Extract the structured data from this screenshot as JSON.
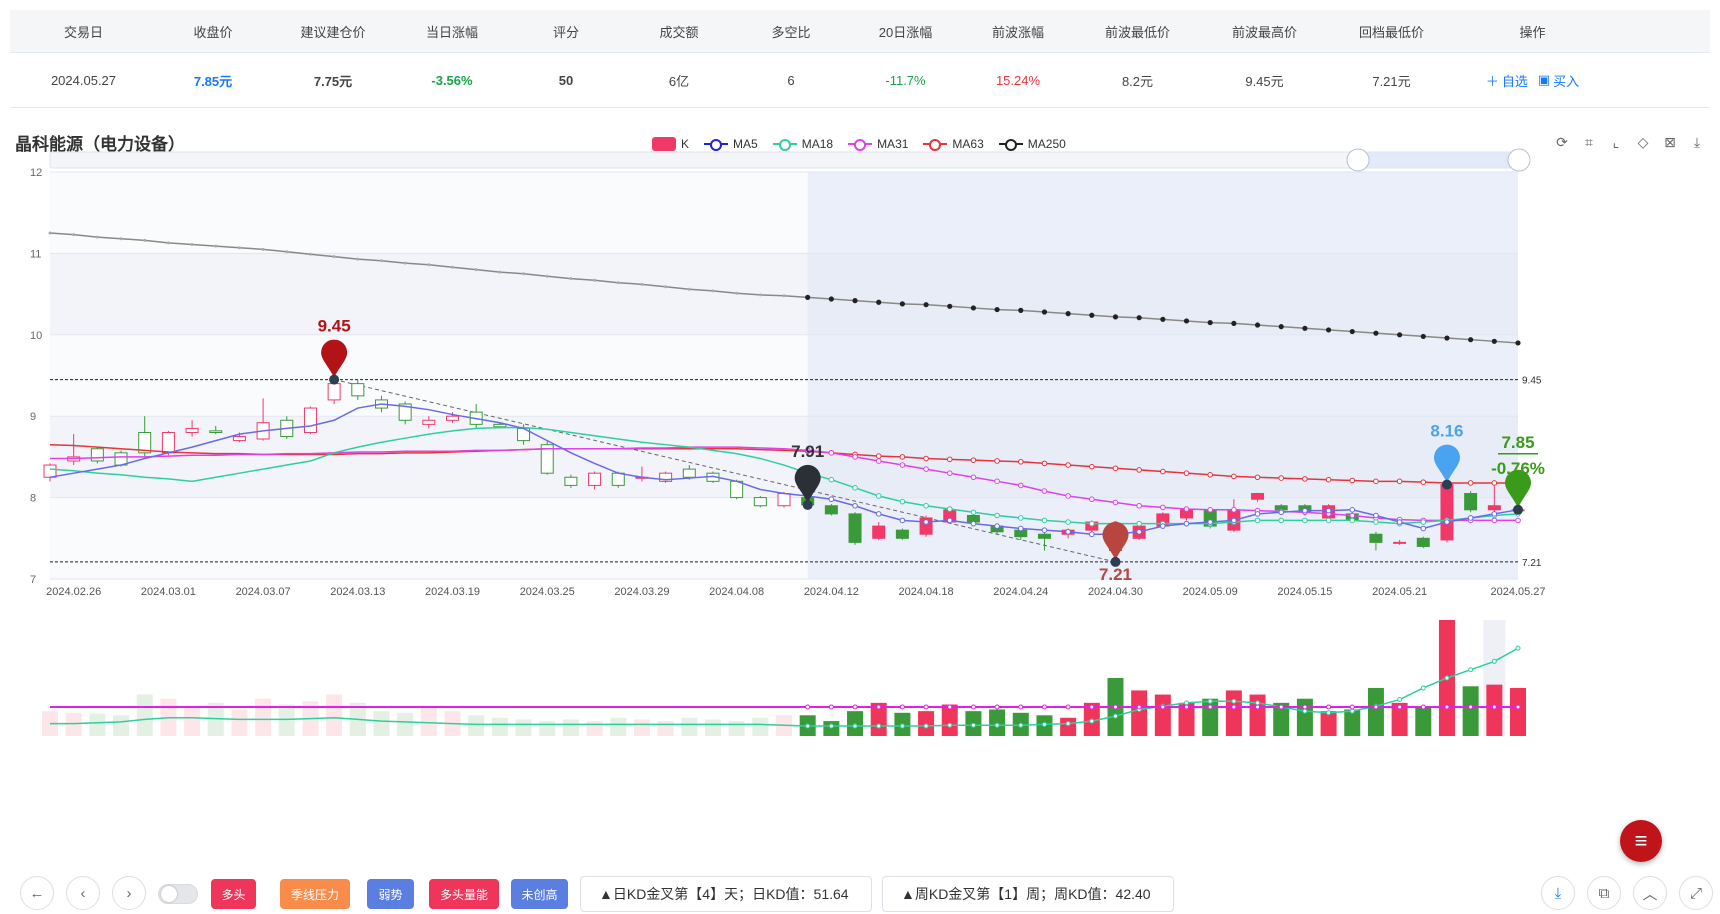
{
  "table": {
    "headers": [
      "交易日",
      "收盘价",
      "建议建仓价",
      "当日涨幅",
      "评分",
      "成交额",
      "多空比",
      "20日涨幅",
      "前波涨幅",
      "前波最低价",
      "前波最高价",
      "回档最低价",
      "操作"
    ],
    "row": {
      "trade_date": "2024.05.27",
      "close": "7.85元",
      "suggest_price": "7.75元",
      "day_change": "-3.56%",
      "score": "50",
      "amount": "6亿",
      "bull_bear": "6",
      "change_20d": "-11.7%",
      "prev_wave_change": "15.24%",
      "prev_wave_low": "8.2元",
      "prev_wave_high": "9.45元",
      "pullback_low": "7.21元"
    },
    "actions": {
      "watchlist": "自选",
      "buy": "买入"
    }
  },
  "chart_title": "晶科能源（电力设备）",
  "legend": [
    {
      "name": "K",
      "color": "#f03968"
    },
    {
      "name": "MA5",
      "color": "#2323d8"
    },
    {
      "name": "MA18",
      "color": "#2ecf9e"
    },
    {
      "name": "MA31",
      "color": "#e040e8"
    },
    {
      "name": "MA63",
      "color": "#e8333a"
    },
    {
      "name": "MA250",
      "color": "#222222"
    }
  ],
  "toolbox_icons": [
    "refresh-icon",
    "zoom-select-icon",
    "zoom-reset-icon",
    "restore-icon",
    "data-view-icon",
    "download-icon"
  ],
  "chart_data": {
    "type": "candlestick",
    "ylim": [
      7,
      12
    ],
    "yticks": [
      "12",
      "11",
      "10",
      "9",
      "8",
      "7"
    ],
    "xticks": [
      "2024.02.26",
      "2024.03.01",
      "2024.03.07",
      "2024.03.13",
      "2024.03.19",
      "2024.03.25",
      "2024.03.29",
      "2024.04.08",
      "2024.04.12",
      "2024.04.18",
      "2024.04.24",
      "2024.04.30",
      "2024.05.09",
      "2024.05.15",
      "2024.05.21",
      "2024.05.27"
    ],
    "candles": [
      [
        8.25,
        8.4,
        8.2,
        8.42
      ],
      [
        8.45,
        8.5,
        8.4,
        8.78
      ],
      [
        8.6,
        8.45,
        8.42,
        8.62
      ],
      [
        8.55,
        8.4,
        8.38,
        8.58
      ],
      [
        8.8,
        8.55,
        8.5,
        9.0
      ],
      [
        8.55,
        8.8,
        8.52,
        8.82
      ],
      [
        8.8,
        8.85,
        8.75,
        8.95
      ],
      [
        8.82,
        8.8,
        8.78,
        8.88
      ],
      [
        8.7,
        8.75,
        8.68,
        8.8
      ],
      [
        8.72,
        8.92,
        8.7,
        9.22
      ],
      [
        8.95,
        8.75,
        8.72,
        9.0
      ],
      [
        8.8,
        9.1,
        8.78,
        9.12
      ],
      [
        9.2,
        9.4,
        9.15,
        9.45
      ],
      [
        9.4,
        9.25,
        9.2,
        9.45
      ],
      [
        9.2,
        9.1,
        9.05,
        9.25
      ],
      [
        9.15,
        8.95,
        8.9,
        9.18
      ],
      [
        8.9,
        8.95,
        8.85,
        9.0
      ],
      [
        8.95,
        9.0,
        8.92,
        9.05
      ],
      [
        9.05,
        8.9,
        8.85,
        9.15
      ],
      [
        8.9,
        8.87,
        8.85,
        8.92
      ],
      [
        8.85,
        8.7,
        8.65,
        8.9
      ],
      [
        8.65,
        8.3,
        8.28,
        8.7
      ],
      [
        8.25,
        8.15,
        8.12,
        8.28
      ],
      [
        8.15,
        8.3,
        8.1,
        8.32
      ],
      [
        8.3,
        8.15,
        8.12,
        8.32
      ],
      [
        8.25,
        8.25,
        8.2,
        8.38
      ],
      [
        8.2,
        8.3,
        8.18,
        8.32
      ],
      [
        8.35,
        8.25,
        8.22,
        8.4
      ],
      [
        8.3,
        8.2,
        8.18,
        8.32
      ],
      [
        8.2,
        8.0,
        7.98,
        8.22
      ],
      [
        8.0,
        7.9,
        7.88,
        8.02
      ],
      [
        7.9,
        8.05,
        7.88,
        8.07
      ],
      [
        8.0,
        7.91,
        7.88,
        8.3
      ],
      [
        7.9,
        7.8,
        7.78,
        7.92
      ],
      [
        7.8,
        7.45,
        7.42,
        7.82
      ],
      [
        7.5,
        7.65,
        7.48,
        7.7
      ],
      [
        7.6,
        7.5,
        7.48,
        7.62
      ],
      [
        7.55,
        7.75,
        7.52,
        7.78
      ],
      [
        7.7,
        7.85,
        7.68,
        7.87
      ],
      [
        7.78,
        7.7,
        7.65,
        7.8
      ],
      [
        7.65,
        7.58,
        7.55,
        7.68
      ],
      [
        7.6,
        7.52,
        7.48,
        7.62
      ],
      [
        7.55,
        7.5,
        7.35,
        7.58
      ],
      [
        7.55,
        7.6,
        7.5,
        7.62
      ],
      [
        7.6,
        7.7,
        7.55,
        7.72
      ],
      [
        7.65,
        7.35,
        7.21,
        7.68
      ],
      [
        7.5,
        7.65,
        7.48,
        7.68
      ],
      [
        7.65,
        7.8,
        7.62,
        7.82
      ],
      [
        7.75,
        7.85,
        7.72,
        7.88
      ],
      [
        7.85,
        7.65,
        7.62,
        7.88
      ],
      [
        7.6,
        7.85,
        7.58,
        7.98
      ],
      [
        7.98,
        8.05,
        7.95,
        8.06
      ],
      [
        7.9,
        7.85,
        7.82,
        7.92
      ],
      [
        7.9,
        7.82,
        7.78,
        7.92
      ],
      [
        7.75,
        7.9,
        7.7,
        7.92
      ],
      [
        7.8,
        7.72,
        7.7,
        7.82
      ],
      [
        7.55,
        7.45,
        7.35,
        7.58
      ],
      [
        7.45,
        7.45,
        7.42,
        7.48
      ],
      [
        7.5,
        7.4,
        7.38,
        7.52
      ],
      [
        7.48,
        8.16,
        7.45,
        8.18
      ],
      [
        8.05,
        7.85,
        7.82,
        8.08
      ],
      [
        7.85,
        7.9,
        7.82,
        8.2
      ],
      [
        7.85,
        7.85,
        7.8,
        7.9
      ]
    ],
    "ma5": [
      8.25,
      8.3,
      8.35,
      8.4,
      8.48,
      8.55,
      8.62,
      8.7,
      8.78,
      8.82,
      8.85,
      8.88,
      8.95,
      9.1,
      9.15,
      9.12,
      9.08,
      9.02,
      8.97,
      8.92,
      8.85,
      8.7,
      8.55,
      8.42,
      8.3,
      8.25,
      8.22,
      8.24,
      8.26,
      8.2,
      8.1,
      8.05,
      8.02,
      7.98,
      7.9,
      7.8,
      7.72,
      7.7,
      7.72,
      7.68,
      7.65,
      7.62,
      7.6,
      7.58,
      7.55,
      7.55,
      7.58,
      7.65,
      7.68,
      7.7,
      7.72,
      7.8,
      7.82,
      7.84,
      7.84,
      7.85,
      7.78,
      7.7,
      7.62,
      7.7,
      7.75,
      7.8,
      7.85
    ],
    "ma18": [
      8.35,
      8.33,
      8.3,
      8.28,
      8.25,
      8.23,
      8.2,
      8.25,
      8.3,
      8.35,
      8.4,
      8.45,
      8.55,
      8.62,
      8.68,
      8.73,
      8.78,
      8.82,
      8.85,
      8.86,
      8.86,
      8.84,
      8.8,
      8.76,
      8.72,
      8.68,
      8.65,
      8.62,
      8.58,
      8.54,
      8.48,
      8.4,
      8.3,
      8.22,
      8.12,
      8.02,
      7.95,
      7.9,
      7.86,
      7.82,
      7.78,
      7.75,
      7.72,
      7.7,
      7.68,
      7.68,
      7.68,
      7.68,
      7.68,
      7.68,
      7.7,
      7.72,
      7.72,
      7.72,
      7.72,
      7.72,
      7.7,
      7.68,
      7.7,
      7.72,
      7.75,
      7.78,
      7.8
    ],
    "ma31": [
      8.48,
      8.48,
      8.49,
      8.5,
      8.5,
      8.51,
      8.52,
      8.52,
      8.53,
      8.53,
      8.54,
      8.54,
      8.55,
      8.56,
      8.56,
      8.57,
      8.57,
      8.57,
      8.58,
      8.58,
      8.59,
      8.6,
      8.6,
      8.6,
      8.6,
      8.61,
      8.61,
      8.62,
      8.62,
      8.62,
      8.61,
      8.6,
      8.58,
      8.55,
      8.5,
      8.45,
      8.4,
      8.35,
      8.3,
      8.25,
      8.2,
      8.15,
      8.08,
      8.02,
      7.98,
      7.94,
      7.9,
      7.88,
      7.86,
      7.85,
      7.85,
      7.84,
      7.83,
      7.82,
      7.8,
      7.78,
      7.75,
      7.73,
      7.72,
      7.72,
      7.72,
      7.72,
      7.72
    ],
    "ma63": [
      8.65,
      8.64,
      8.62,
      8.6,
      8.58,
      8.56,
      8.55,
      8.54,
      8.54,
      8.53,
      8.53,
      8.53,
      8.53,
      8.54,
      8.54,
      8.55,
      8.55,
      8.56,
      8.57,
      8.58,
      8.59,
      8.6,
      8.6,
      8.6,
      8.6,
      8.6,
      8.6,
      8.6,
      8.6,
      8.6,
      8.59,
      8.58,
      8.57,
      8.55,
      8.53,
      8.51,
      8.5,
      8.48,
      8.47,
      8.46,
      8.45,
      8.44,
      8.42,
      8.4,
      8.38,
      8.36,
      8.34,
      8.32,
      8.3,
      8.28,
      8.26,
      8.25,
      8.24,
      8.23,
      8.22,
      8.21,
      8.2,
      8.2,
      8.19,
      8.18,
      8.18,
      8.18,
      8.18
    ],
    "ma250": [
      11.25,
      11.23,
      11.2,
      11.18,
      11.16,
      11.13,
      11.11,
      11.09,
      11.07,
      11.05,
      11.02,
      10.99,
      10.96,
      10.93,
      10.91,
      10.88,
      10.86,
      10.83,
      10.8,
      10.77,
      10.75,
      10.72,
      10.69,
      10.67,
      10.64,
      10.62,
      10.59,
      10.56,
      10.54,
      10.51,
      10.49,
      10.48,
      10.46,
      10.44,
      10.42,
      10.4,
      10.38,
      10.37,
      10.35,
      10.33,
      10.31,
      10.3,
      10.28,
      10.26,
      10.24,
      10.22,
      10.21,
      10.19,
      10.17,
      10.15,
      10.14,
      10.12,
      10.1,
      10.08,
      10.06,
      10.04,
      10.02,
      10.0,
      9.98,
      9.96,
      9.94,
      9.92,
      9.9
    ],
    "volume": [
      30,
      28,
      27,
      25,
      50,
      45,
      35,
      40,
      32,
      45,
      38,
      42,
      50,
      40,
      30,
      28,
      35,
      30,
      25,
      22,
      20,
      18,
      20,
      18,
      22,
      20,
      18,
      22,
      20,
      18,
      22,
      25,
      25,
      18,
      30,
      40,
      28,
      30,
      38,
      30,
      32,
      28,
      25,
      22,
      40,
      70,
      55,
      50,
      40,
      45,
      55,
      50,
      40,
      45,
      30,
      32,
      58,
      40,
      35,
      140,
      60,
      62,
      58
    ],
    "vol_line_a": [
      15,
      15,
      16,
      17,
      20,
      22,
      22,
      21,
      20,
      20,
      20,
      21,
      22,
      20,
      18,
      17,
      16,
      15,
      14,
      14,
      14,
      14,
      14,
      14,
      14,
      14,
      14,
      14,
      14,
      14,
      14,
      13,
      12,
      12,
      12,
      12,
      12,
      12,
      13,
      13,
      13,
      13,
      14,
      15,
      18,
      24,
      32,
      36,
      40,
      42,
      42,
      40,
      35,
      30,
      28,
      30,
      36,
      44,
      58,
      70,
      80,
      90,
      106
    ],
    "vol_line_b": [
      35,
      35,
      35,
      35,
      35,
      35,
      35,
      35,
      35,
      35,
      35,
      35,
      35,
      35,
      35,
      35,
      35,
      35,
      35,
      35,
      35,
      35,
      35,
      35,
      35,
      35,
      35,
      35,
      35,
      35,
      35,
      35,
      35,
      35,
      35,
      35,
      35,
      35,
      35,
      35,
      35,
      35,
      35,
      35,
      35,
      35,
      35,
      35,
      35,
      35,
      35,
      35,
      35,
      35,
      35,
      35,
      35,
      35,
      35,
      35,
      35,
      35,
      35
    ],
    "annotations": {
      "high_label": "9.45",
      "mid_label": "7.91",
      "low_label": "7.21",
      "recent_label": "8.16",
      "last_price": "7.85",
      "last_change": "-0.76%",
      "hline_high": "9.45",
      "hline_low": "7.21"
    },
    "grid": true
  },
  "bottom": {
    "tags": [
      {
        "label": "多头",
        "color": "#f0355a"
      },
      {
        "label": "季线压力",
        "color": "#f98b4b"
      },
      {
        "label": "弱势",
        "color": "#5b7fe0"
      },
      {
        "label": "多头量能",
        "color": "#f0355a"
      },
      {
        "label": "未创高",
        "color": "#5b7fe0"
      }
    ],
    "info_day": "▲日KD金叉第【4】天；日KD值：51.64",
    "info_week": "▲周KD金叉第【1】周；周KD值：42.40"
  }
}
